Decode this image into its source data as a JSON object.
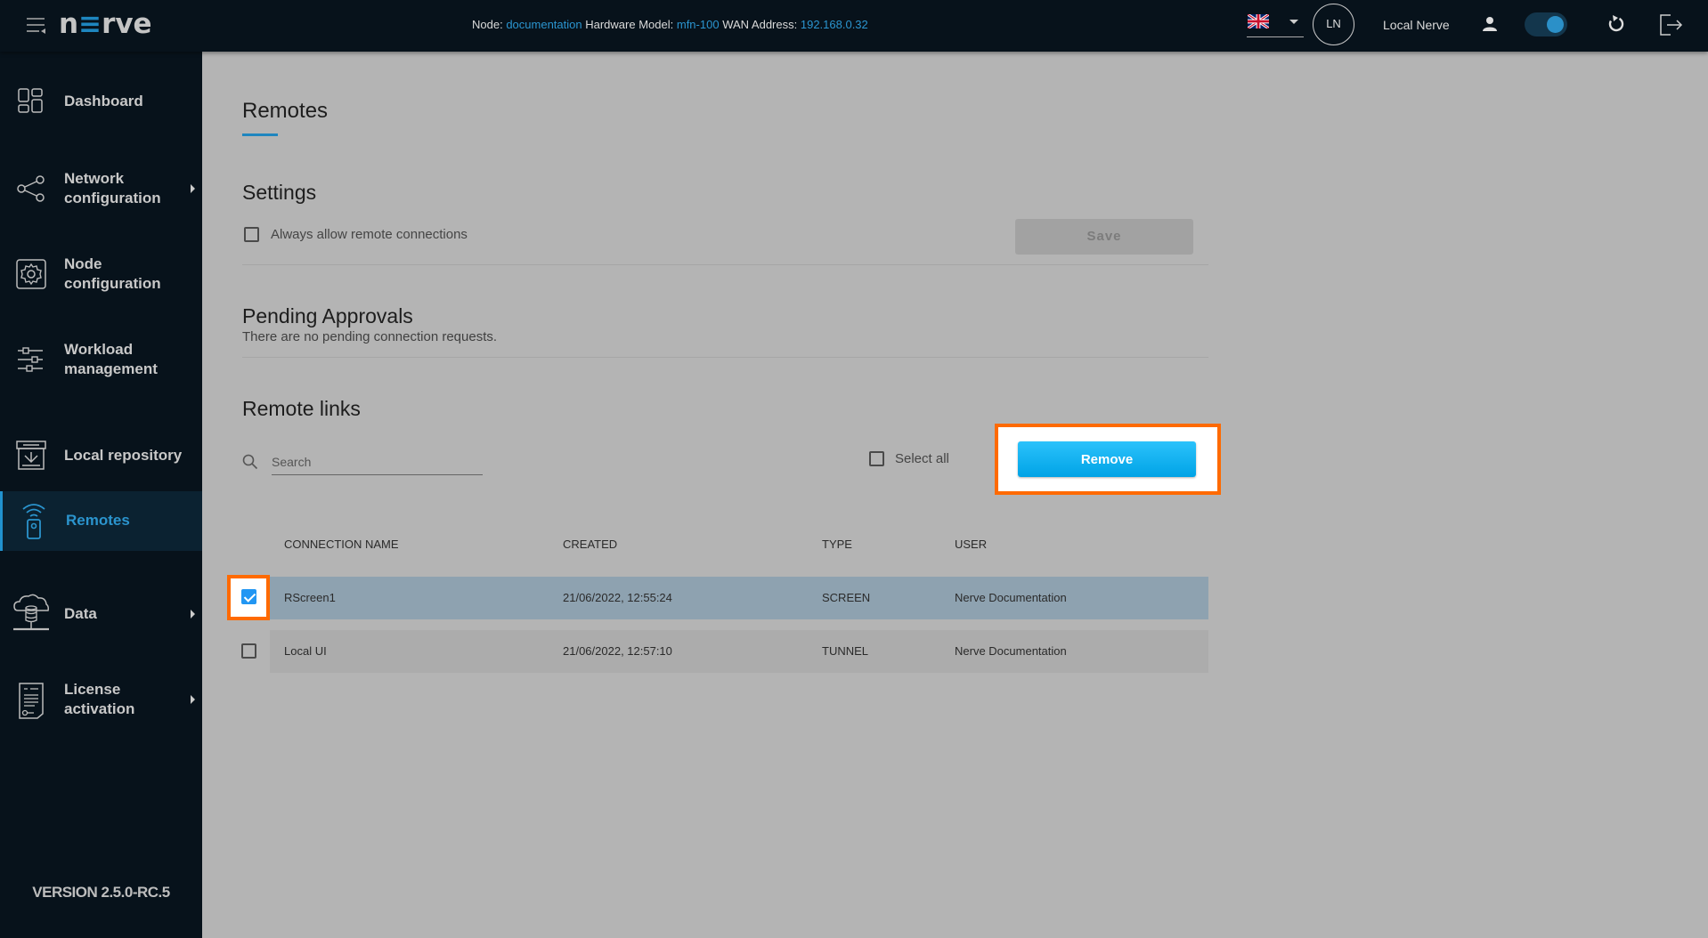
{
  "header": {
    "menu_icon": "menu-collapse-icon",
    "logo": {
      "pre": "n",
      "mid": "≡",
      "post": "rve"
    },
    "node_label": "Node:",
    "node_value": "documentation",
    "hw_label": "Hardware Model:",
    "hw_value": "mfn-100",
    "wan_label": "WAN Address:",
    "wan_value": "192.168.0.32",
    "language": "en-GB",
    "avatar_initials": "LN",
    "user_name": "Local Nerve",
    "toggle_on": true
  },
  "sidebar": {
    "items": [
      {
        "label": "Dashboard",
        "icon": "dashboard-icon",
        "submenu": false
      },
      {
        "label": "Network\nconfiguration",
        "icon": "share-network-icon",
        "submenu": true
      },
      {
        "label": "Node\nconfiguration",
        "icon": "gear-icon",
        "submenu": false
      },
      {
        "label": "Workload\nmanagement",
        "icon": "sliders-icon",
        "submenu": false
      },
      {
        "label": "Local repository",
        "icon": "repository-download-icon",
        "submenu": false
      },
      {
        "label": "Remotes",
        "icon": "remote-wifi-icon",
        "submenu": false,
        "active": true
      },
      {
        "label": "Data",
        "icon": "cloud-database-icon",
        "submenu": true
      },
      {
        "label": "License\nactivation",
        "icon": "license-document-icon",
        "submenu": true
      }
    ],
    "version": "VERSION 2.5.0-RC.5"
  },
  "main": {
    "page_title": "Remotes",
    "settings": {
      "title": "Settings",
      "always_allow_label": "Always allow remote connections",
      "always_allow_checked": false,
      "save_label": "Save"
    },
    "pending": {
      "title": "Pending Approvals",
      "empty_text": "There are no pending connection requests."
    },
    "remote_links": {
      "title": "Remote links",
      "search_placeholder": "Search",
      "select_all_label": "Select all",
      "remove_label": "Remove",
      "columns": [
        "CONNECTION NAME",
        "CREATED",
        "TYPE",
        "USER"
      ],
      "rows": [
        {
          "name": "RScreen1",
          "created": "21/06/2022, 12:55:24",
          "type": "SCREEN",
          "user": "Nerve Documentation",
          "checked": true
        },
        {
          "name": "Local UI",
          "created": "21/06/2022, 12:57:10",
          "type": "TUNNEL",
          "user": "Nerve Documentation",
          "checked": false
        }
      ]
    }
  },
  "colors": {
    "accent": "#1f86bf",
    "highlight": "#ff6a00",
    "remove_button": "#00a3e6",
    "selected_row": "#8ea2b0"
  }
}
